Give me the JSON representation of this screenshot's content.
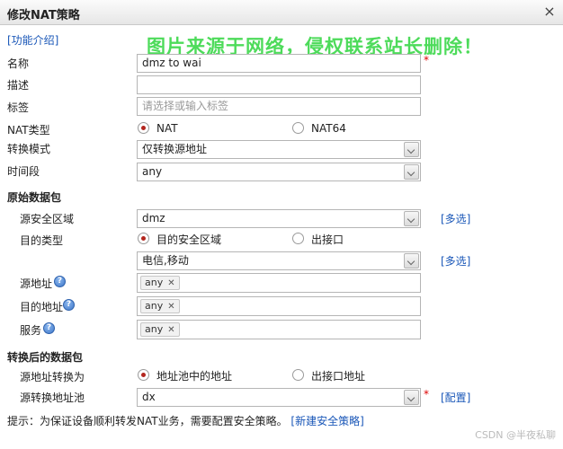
{
  "dialog": {
    "title": "修改NAT策略",
    "close": "×"
  },
  "help_link": "[功能介绍]",
  "watermark": "图片来源于网络，侵权联系站长删除！",
  "form": {
    "name_label": "名称",
    "name_value": "dmz to wai",
    "desc_label": "描述",
    "desc_value": "",
    "tag_label": "标签",
    "tag_placeholder": "请选择或输入标签",
    "nattype_label": "NAT类型",
    "nattype_options": [
      "NAT",
      "NAT64"
    ],
    "mode_label": "转换模式",
    "mode_value": "仅转换源地址",
    "time_label": "时间段",
    "time_value": "any"
  },
  "original": {
    "section": "原始数据包",
    "src_zone_label": "源安全区域",
    "src_zone_value": "dmz",
    "multi_select": "[多选]",
    "dst_type_label": "目的类型",
    "dst_type_options": [
      "目的安全区域",
      "出接口"
    ],
    "dst_zone_value": "电信,移动",
    "src_addr_label": "源地址",
    "src_addr_tag": "any",
    "dst_addr_label": "目的地址",
    "dst_addr_tag": "any",
    "service_label": "服务",
    "service_tag": "any"
  },
  "translated": {
    "section": "转换后的数据包",
    "convert_label": "源地址转换为",
    "convert_options": [
      "地址池中的地址",
      "出接口地址"
    ],
    "pool_label": "源转换地址池",
    "pool_value": "dx",
    "config_link": "[配置]"
  },
  "footer": {
    "hint": "提示：为保证设备顺利转发NAT业务，需要配置安全策略。",
    "new_policy_link": "[新建安全策略]"
  },
  "credit": "CSDN @半夜私聊"
}
